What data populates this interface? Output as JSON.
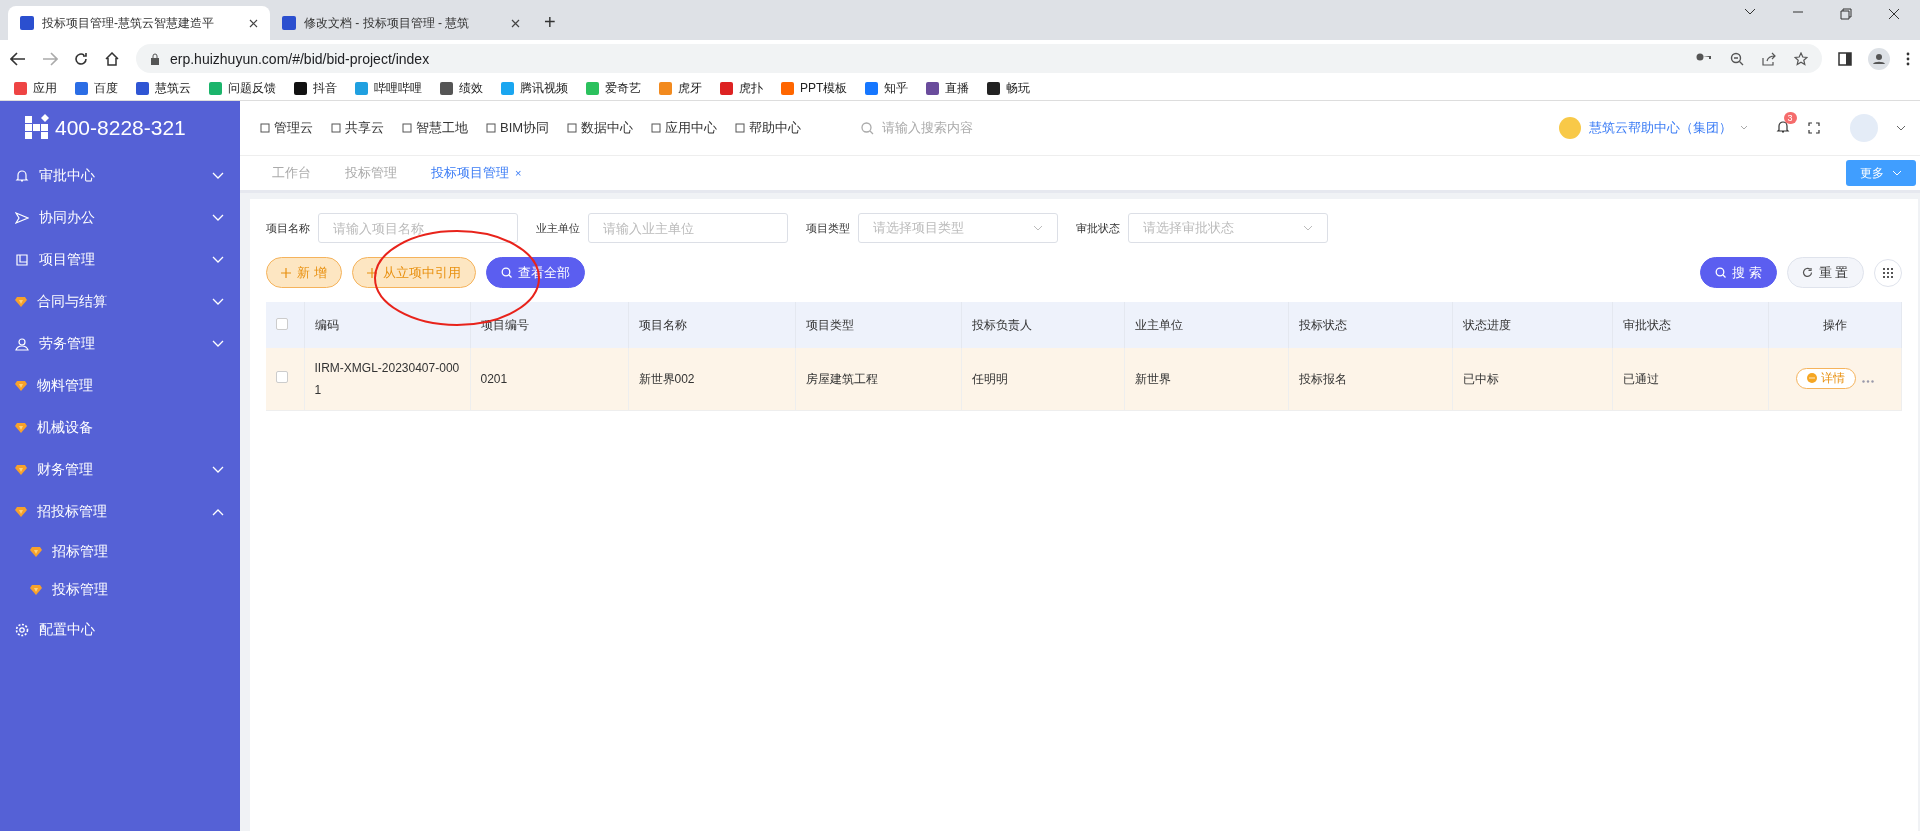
{
  "browser": {
    "tabs": [
      {
        "title": "投标项目管理-慧筑云智慧建造平",
        "selected": true
      },
      {
        "title": "修改文档 - 投标项目管理 - 慧筑",
        "selected": false
      }
    ],
    "new_tab": "+",
    "url": "erp.huizhuyun.com/#/bid/bid-project/index",
    "bookmarks": [
      "应用",
      "百度",
      "慧筑云",
      "问题反馈",
      "抖音",
      "哔哩哔哩",
      "绩效",
      "腾讯视频",
      "爱奇艺",
      "虎牙",
      "虎扑",
      "PPT模板",
      "知乎",
      "直播",
      "畅玩"
    ]
  },
  "sidebar": {
    "phone": "400-8228-321",
    "items": [
      {
        "label": "审批中心",
        "kind": "group",
        "expanded": false
      },
      {
        "label": "协同办公",
        "kind": "group",
        "expanded": false
      },
      {
        "label": "项目管理",
        "kind": "group",
        "expanded": false
      },
      {
        "label": "合同与结算",
        "kind": "group",
        "expanded": false
      },
      {
        "label": "劳务管理",
        "kind": "group",
        "expanded": false
      },
      {
        "label": "物料管理",
        "kind": "link"
      },
      {
        "label": "机械设备",
        "kind": "link"
      },
      {
        "label": "财务管理",
        "kind": "group",
        "expanded": false
      },
      {
        "label": "招投标管理",
        "kind": "group",
        "expanded": true,
        "children": [
          {
            "label": "招标管理"
          },
          {
            "label": "投标管理"
          }
        ]
      },
      {
        "label": "配置中心",
        "kind": "link"
      }
    ]
  },
  "topnav": {
    "items": [
      "管理云",
      "共享云",
      "智慧工地",
      "BIM协同",
      "数据中心",
      "应用中心",
      "帮助中心"
    ],
    "search_placeholder": "请输入搜索内容",
    "org": "慧筑云帮助中心（集团）",
    "notifications": "3"
  },
  "page_tabs": {
    "tabs": [
      {
        "label": "工作台",
        "selected": false
      },
      {
        "label": "投标管理",
        "selected": false
      },
      {
        "label": "投标项目管理",
        "selected": true,
        "close": "×"
      }
    ],
    "more": "更多"
  },
  "filters": [
    {
      "label": "项目名称",
      "kind": "input",
      "placeholder": "请输入项目名称"
    },
    {
      "label": "业主单位",
      "kind": "input",
      "placeholder": "请输入业主单位"
    },
    {
      "label": "项目类型",
      "kind": "select",
      "placeholder": "请选择项目类型"
    },
    {
      "label": "审批状态",
      "kind": "select",
      "placeholder": "请选择审批状态"
    }
  ],
  "actions": {
    "add": "新 增",
    "import": "从立项中引用",
    "view_all": "查看全部",
    "search": "搜 索",
    "reset": "重 置"
  },
  "table": {
    "columns": [
      "编码",
      "项目编号",
      "项目名称",
      "项目类型",
      "投标负责人",
      "业主单位",
      "投标状态",
      "状态进度",
      "审批状态",
      "操作"
    ],
    "all_checked": false,
    "rows": [
      {
        "checked": false,
        "highlighted": true,
        "cells": [
          "IIRM-XMGL-20230407-0001",
          "0201",
          "新世界002",
          "房屋建筑工程",
          "任明明",
          "新世界",
          "投标报名",
          "已中标",
          "已通过"
        ],
        "detail": "详情"
      }
    ]
  }
}
